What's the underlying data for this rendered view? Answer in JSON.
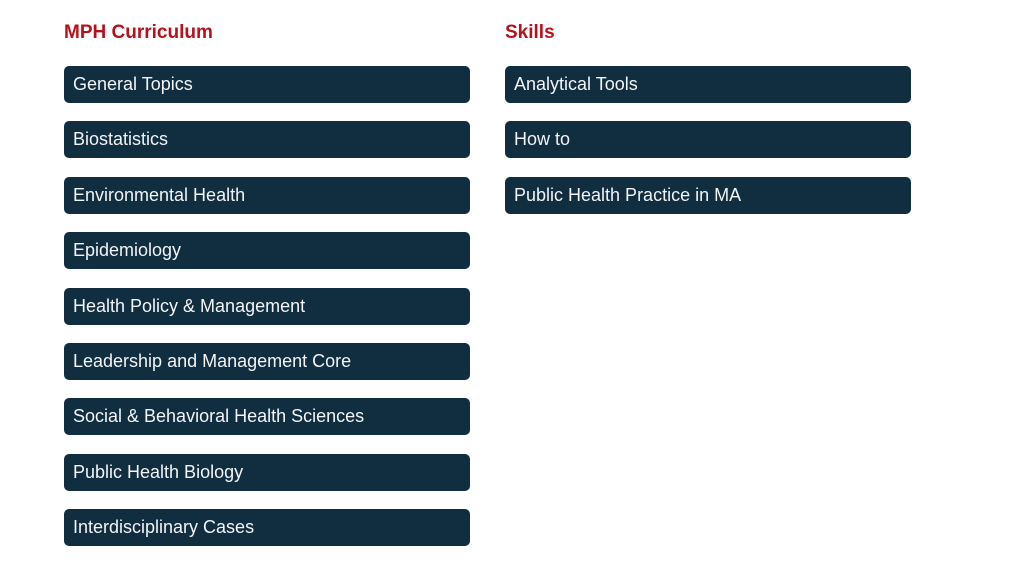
{
  "curriculum": {
    "heading": "MPH Curriculum",
    "items": [
      {
        "label": "General Topics"
      },
      {
        "label": "Biostatistics"
      },
      {
        "label": "Environmental Health"
      },
      {
        "label": "Epidemiology"
      },
      {
        "label": "Health Policy & Management"
      },
      {
        "label": "Leadership and Management Core"
      },
      {
        "label": "Social & Behavioral Health Sciences"
      },
      {
        "label": "Public Health Biology"
      },
      {
        "label": "Interdisciplinary Cases"
      }
    ]
  },
  "skills": {
    "heading": "Skills",
    "items": [
      {
        "label": "Analytical Tools"
      },
      {
        "label": "How to"
      },
      {
        "label": "Public Health Practice in MA"
      }
    ]
  },
  "colors": {
    "heading": "#b5121b",
    "button_bg": "#112d40",
    "button_text": "#f2f4f6"
  }
}
